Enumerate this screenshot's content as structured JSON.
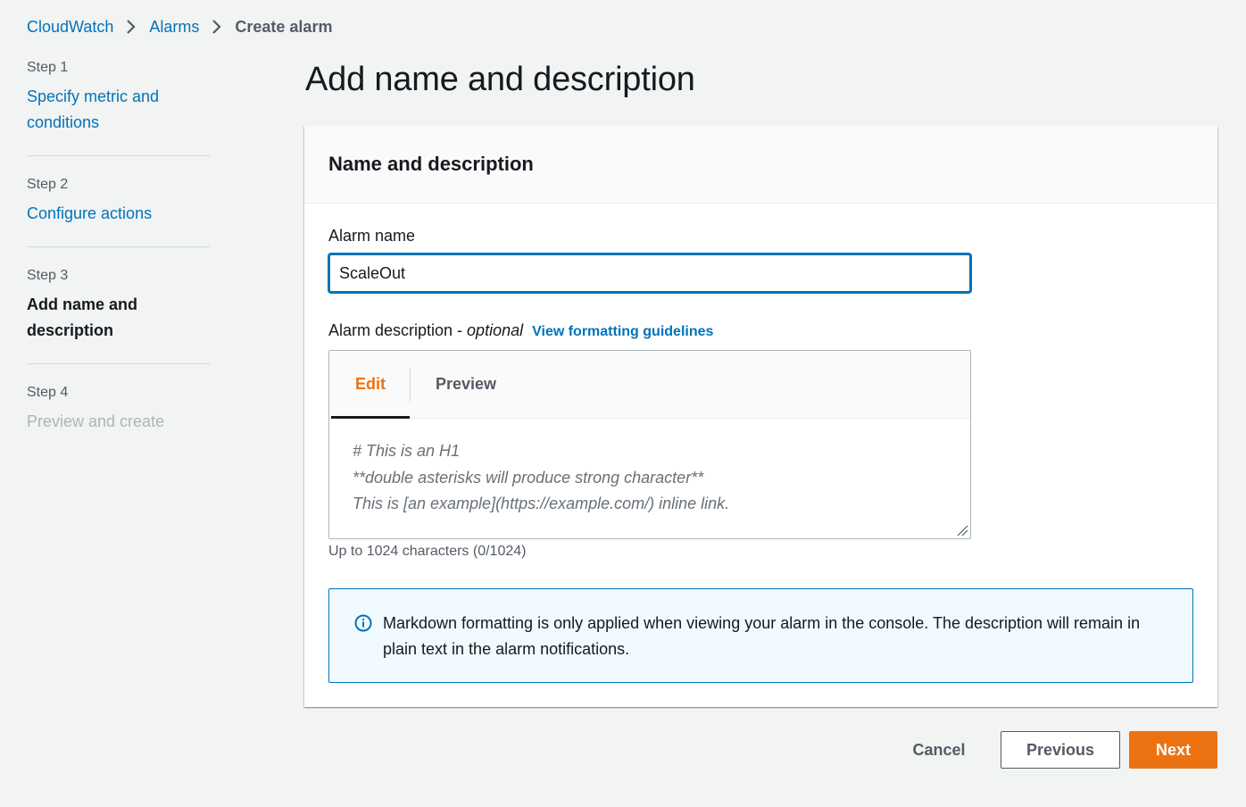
{
  "breadcrumb": {
    "items": [
      {
        "label": "CloudWatch"
      },
      {
        "label": "Alarms"
      },
      {
        "label": "Create alarm"
      }
    ]
  },
  "steps": [
    {
      "number": "Step 1",
      "title": "Specify metric and conditions",
      "state": "link"
    },
    {
      "number": "Step 2",
      "title": "Configure actions",
      "state": "link"
    },
    {
      "number": "Step 3",
      "title": "Add name and description",
      "state": "active"
    },
    {
      "number": "Step 4",
      "title": "Preview and create",
      "state": "disabled"
    }
  ],
  "page_title": "Add name and description",
  "panel": {
    "header": "Name and description",
    "alarm_name_label": "Alarm name",
    "alarm_name_value": "ScaleOut",
    "description_label": "Alarm description -",
    "description_optional": "optional",
    "formatting_link": "View formatting guidelines",
    "editor": {
      "tab_edit": "Edit",
      "tab_preview": "Preview",
      "placeholder_lines": [
        "# This is an H1",
        "**double asterisks will produce strong character**",
        "This is [an example](https://example.com/) inline link."
      ]
    },
    "char_count": "Up to 1024 characters (0/1024)",
    "info_alert": "Markdown formatting is only applied when viewing your alarm in the console. The description will remain in plain text in the alarm notifications."
  },
  "footer": {
    "cancel": "Cancel",
    "previous": "Previous",
    "next": "Next"
  },
  "colors": {
    "link": "#0073bb",
    "primary_button": "#ec7211",
    "active_tab": "#ec7211",
    "page_background": "#f2f3f3",
    "info_background": "#f1faff"
  },
  "icons": [
    "chevron-right-icon",
    "info-circle-icon",
    "resize-handle-icon"
  ]
}
